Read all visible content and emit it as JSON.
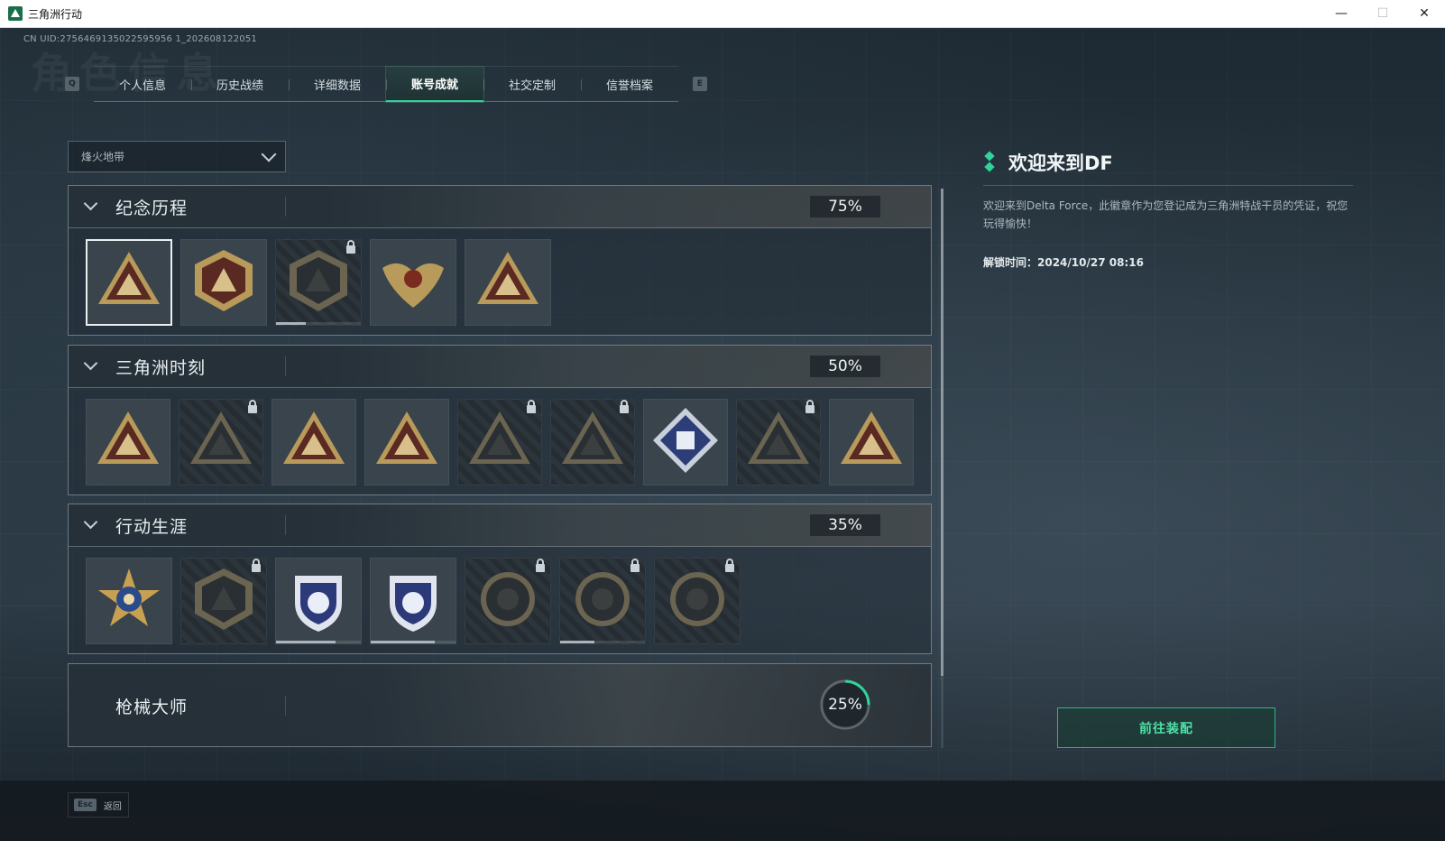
{
  "window": {
    "title": "三角洲行动",
    "controls": [
      "—",
      "☐",
      "✕"
    ]
  },
  "uid": "CN UID:2756469135022595956 1_202608122051",
  "tabs": {
    "left_key": "Q",
    "right_key": "E",
    "items": [
      "个人信息",
      "历史战绩",
      "详细数据",
      "账号成就",
      "社交定制",
      "信誉档案"
    ],
    "active_index": 3
  },
  "filter": {
    "selected": "烽火地带"
  },
  "sections": [
    {
      "title": "纪念历程",
      "percent": "75%",
      "expanded": true,
      "badges": [
        {
          "icon": "triangle-emblem-badge-icon",
          "locked": false,
          "selected": true
        },
        {
          "icon": "helicopter-badge-icon",
          "locked": false
        },
        {
          "icon": "dark-hex-badge-icon",
          "locked": true,
          "progress": 0.35
        },
        {
          "icon": "winged-eagle-badge-icon",
          "locked": false
        },
        {
          "icon": "number-one-triangle-badge-icon",
          "locked": false
        }
      ]
    },
    {
      "title": "三角洲时刻",
      "percent": "50%",
      "expanded": true,
      "badges": [
        {
          "icon": "cargo-box-badge-icon",
          "locked": false
        },
        {
          "icon": "soldier-badge-icon",
          "locked": true
        },
        {
          "icon": "hex-star-badge-icon",
          "locked": false
        },
        {
          "icon": "squad-badge-icon",
          "locked": false
        },
        {
          "icon": "commander-badge-icon",
          "locked": true
        },
        {
          "icon": "dragon-badge-icon",
          "locked": true
        },
        {
          "icon": "cube-gem-badge-icon",
          "locked": false
        },
        {
          "icon": "serpent-badge-icon",
          "locked": true
        },
        {
          "icon": "operator-badge-icon",
          "locked": false
        }
      ]
    },
    {
      "title": "行动生涯",
      "percent": "35%",
      "expanded": true,
      "badges": [
        {
          "icon": "star-medal-badge-icon",
          "locked": false
        },
        {
          "icon": "shield-chevron-badge-icon",
          "locked": true
        },
        {
          "icon": "blue-shield-badge-icon",
          "locked": false,
          "progress": 0.7
        },
        {
          "icon": "blue-crest-badge-icon",
          "locked": false,
          "progress": 0.75
        },
        {
          "icon": "round-seal-badge-icon",
          "locked": true
        },
        {
          "icon": "skull-target-badge-icon",
          "locked": true,
          "progress": 0.4
        },
        {
          "icon": "eye-seal-badge-icon",
          "locked": true
        }
      ]
    },
    {
      "title": "枪械大师",
      "percent": "25%",
      "expanded": false,
      "progress": 0.25
    }
  ],
  "detail": {
    "title": "欢迎来到DF",
    "description": "欢迎来到Delta Force，此徽章作为您登记成为三角洲特战干员的凭证，祝您玩得愉快！",
    "unlock_time": "解锁时间：2024/10/27 08:16"
  },
  "equip_button": "前往装配",
  "footer": {
    "key": "Esc",
    "label": "返回"
  },
  "colors": {
    "accent": "#2fd49a",
    "panel": "#1e2a33"
  }
}
